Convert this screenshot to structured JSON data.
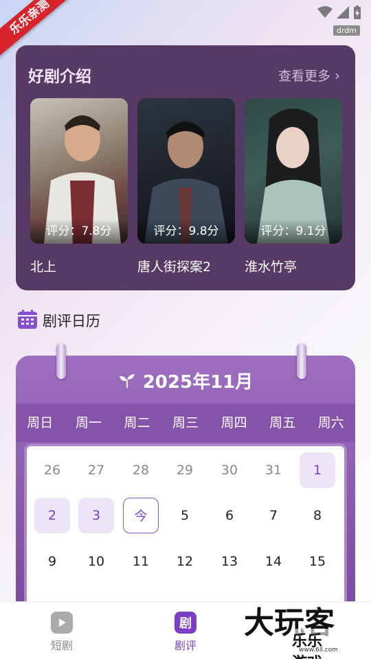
{
  "ribbon": "乐乐亲测",
  "status_tag": "drdm",
  "featured": {
    "title": "好剧介绍",
    "more": "查看更多",
    "dramas": [
      {
        "name": "北上",
        "score": "评分：7.8分"
      },
      {
        "name": "唐人街探案2",
        "score": "评分：9.8分"
      },
      {
        "name": "淮水竹亭",
        "score": "评分：9.1分"
      }
    ]
  },
  "calendar": {
    "section_title": "剧评日历",
    "month_title": "2025年11月",
    "weekdays": [
      "周日",
      "周一",
      "周二",
      "周三",
      "周四",
      "周五",
      "周六"
    ],
    "row1": [
      "26",
      "27",
      "28",
      "29",
      "30",
      "31",
      "1"
    ],
    "row2": [
      "2",
      "3",
      "今",
      "5",
      "6",
      "7",
      "8"
    ],
    "row3": [
      "9",
      "10",
      "11",
      "12",
      "13",
      "14",
      "15"
    ]
  },
  "nav": {
    "item1": "短剧",
    "item2": "剧评",
    "item2_icon_char": "剧"
  },
  "watermark": {
    "big": "大玩客",
    "small": "乐乐游戏",
    "url": "www.6ll.com"
  },
  "colors": {
    "card": "#573965",
    "calendar": "#8553aa",
    "accent": "#7b3fc4"
  }
}
